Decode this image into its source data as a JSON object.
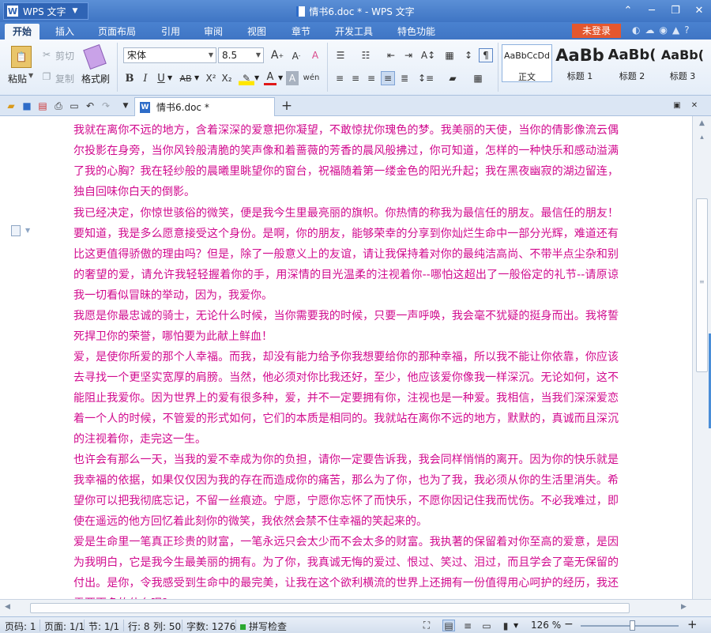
{
  "window": {
    "app_menu_label": "WPS 文字",
    "title": "情书6.doc * - WPS 文字",
    "minimize": "─",
    "restore": "❐",
    "close": "✕",
    "pin": "⌃"
  },
  "menu": {
    "tabs": [
      "开始",
      "插入",
      "页面布局",
      "引用",
      "审阅",
      "视图",
      "章节",
      "开发工具",
      "特色功能"
    ],
    "login_label": "未登录",
    "help_label": "?"
  },
  "ribbon": {
    "paste_label": "粘贴",
    "cut_label": "剪切",
    "copy_label": "复制",
    "format_painter_label": "格式刷",
    "font_name": "宋体",
    "font_size": "8.5",
    "bold": "B",
    "italic": "I",
    "underline": "U",
    "strike": "AB",
    "superscript": "X²",
    "subscript": "X₂",
    "font_color": "A",
    "styles": [
      {
        "sample": "AaBbCcDd",
        "name": "正文"
      },
      {
        "sample": "AaBb",
        "name": "标题 1"
      },
      {
        "sample": "AaBb(",
        "name": "标题 2"
      },
      {
        "sample": "AaBb(",
        "name": "标题 3"
      }
    ]
  },
  "doc_tab": {
    "label": "情书6.doc *",
    "add": "+"
  },
  "document": {
    "paragraphs": [
      "我就在离你不远的地方，含着深深的爱意把你凝望，不敢惊扰你瑰色的梦。我美丽的天使，当你的倩影像流云偶尔投影在身旁，当你风铃般清脆的笑声像和着蔷薇的芳香的晨风般拂过，你可知道，怎样的一种快乐和感动溢满了我的心胸？我在轻纱般的晨曦里眺望你的窗台，祝福随着第一缕金色的阳光升起；我在黑夜幽寂的湖边留连，独自回味你白天的倒影。",
      "我已经决定，你惊世骇俗的微笑，便是我今生里最亮丽的旗帜。你热情的称我为最信任的朋友。最信任的朋友！要知道，我是多么愿意接受这个身份。是啊，你的朋友，能够荣幸的分享到你灿烂生命中一部分光辉，难道还有比这更值得骄傲的理由吗？但是，除了一般意义上的友谊，请让我保持着对你的最纯洁高尚、不带半点尘杂和别的奢望的爱，请允许我轻轻握着你的手，用深情的目光温柔的注视着你--哪怕这超出了一般俗定的礼节--请原谅我一切看似冒昧的举动，因为，我爱你。",
      "我愿是你最忠诚的骑士，无论什么时候，当你需要我的时候，只要一声呼唤，我会毫不犹疑的挺身而出。我将誓死捍卫你的荣誉，哪怕要为此献上鲜血！",
      "爱，是使你所爱的那个人幸福。而我，却没有能力给予你我想要给你的那种幸福，所以我不能让你依靠，你应该去寻找一个更坚实宽厚的肩膀。当然，他必须对你比我还好，至少，他应该爱你像我一样深沉。无论如何，这不能阻止我爱你。因为世界上的爱有很多种，爱，并不一定要拥有你，注视也是一种爱。我相信，当我们深深爱恋着一个人的时候，不管爱的形式如何，它们的本质是相同的。我就站在离你不远的地方，默默的，真诚而且深沉的注视着你，走完这一生。",
      "也许会有那么一天，当我的爱不幸成为你的负担，请你一定要告诉我，我会同样悄悄的离开。因为你的快乐就是我幸福的依据，如果仅仅因为我的存在而造成你的痛苦，那么为了你，也为了我，我必须从你的生活里消失。希望你可以把我彻底忘记，不留一丝痕迹。宁愿，宁愿你忘怀了而快乐，不愿你因记住我而忧伤。不必我难过，即使在遥远的他方回忆着此刻你的微笑，我依然会禁不住幸福的笑起来的。",
      "爱是生命里一笔真正珍贵的财富，一笔永远只会太少而不会太多的财富。我执著的保留着对你至高的爱意，是因为我明白，它是我今生最美丽的拥有。为了你，我真诚无悔的爱过、恨过、笑过、泪过，而且学会了毫无保留的付出。是你，令我感受到生命中的最完美，让我在这个欲利横流的世界上还拥有一份值得用心呵护的经历，我还需要更多的什么呢？"
    ]
  },
  "status": {
    "page_code": "页码: 1",
    "pages": "页面: 1/1",
    "section": "节: 1/1",
    "row": "行: 8",
    "col": "列: 50",
    "words": "字数: 1276",
    "spell_check": "拼写检查",
    "zoom": "126 %",
    "zoom_level": 0.5
  },
  "colors": {
    "text": "#d10a8e",
    "title_bar": "#3f75c4",
    "login": "#e4572e"
  }
}
